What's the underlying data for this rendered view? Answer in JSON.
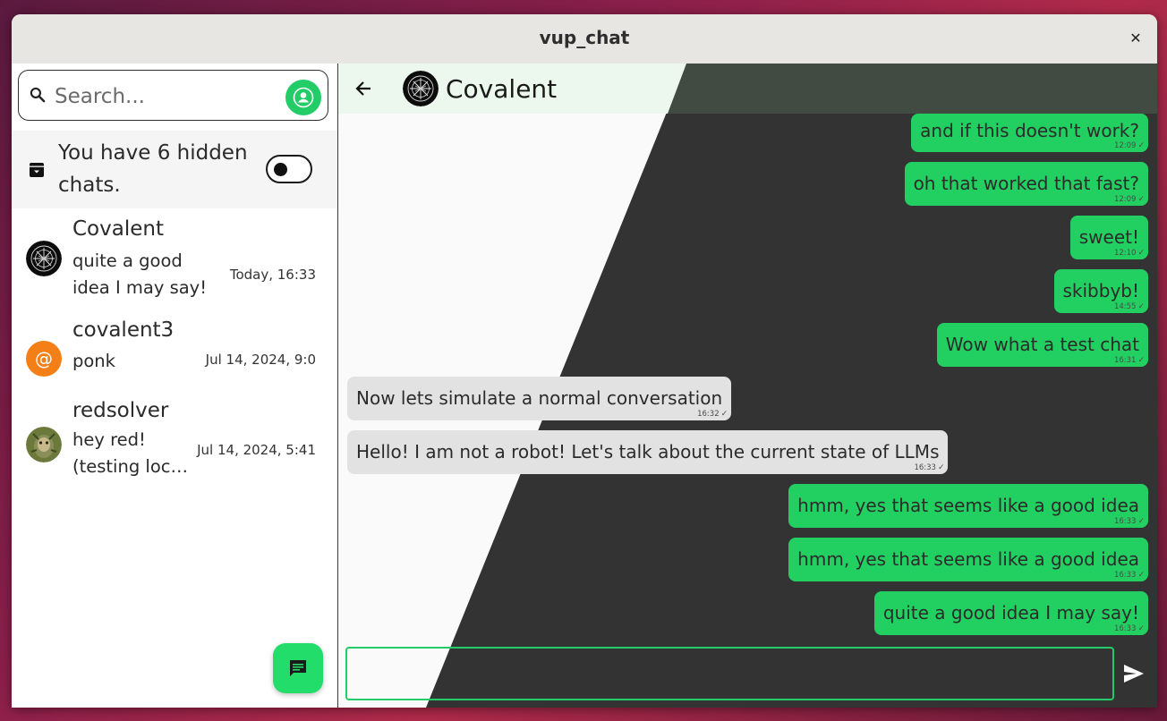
{
  "window": {
    "title": "vup_chat"
  },
  "sidebar": {
    "search_placeholder": "Search...",
    "hidden_chats_text": "You have 6 hidden chats.",
    "hidden_toggle_on": false,
    "chats": [
      {
        "name": "Covalent",
        "preview": "quite a good idea I may say!",
        "time": "Today, 16:33",
        "avatar": "covalent-logo"
      },
      {
        "name": "covalent3",
        "preview": "ponk",
        "time": "Jul 14, 2024, 9:0",
        "avatar": "at-sign",
        "avatar_color": "#f57f17"
      },
      {
        "name": "redsolver",
        "preview": "hey red! (testing loc…",
        "time": "Jul 14, 2024, 5:41",
        "avatar": "photo"
      }
    ]
  },
  "chat": {
    "name": "Covalent",
    "messages": [
      {
        "text": "and if this doesn't work?",
        "time": "12:09",
        "dir": "out"
      },
      {
        "text": "oh that worked that fast?",
        "time": "12:09",
        "dir": "out"
      },
      {
        "text": "sweet!",
        "time": "12:10",
        "dir": "out"
      },
      {
        "text": "skibbyb!",
        "time": "14:55",
        "dir": "out"
      },
      {
        "text": "Wow what a test chat",
        "time": "16:31",
        "dir": "out"
      },
      {
        "text": "Now lets simulate a normal conversation",
        "time": "16:32",
        "dir": "in"
      },
      {
        "text": "Hello! I am not a robot! Let's talk about the current state of LLMs",
        "time": "16:33",
        "dir": "in"
      },
      {
        "text": "hmm, yes that seems like a good idea",
        "time": "16:33",
        "dir": "out"
      },
      {
        "text": "hmm, yes that seems like a good idea",
        "time": "16:33",
        "dir": "out"
      },
      {
        "text": "quite a good idea I may say!",
        "time": "16:33",
        "dir": "out"
      }
    ],
    "input_value": ""
  },
  "colors": {
    "accent": "#22cc66",
    "outgoing_bubble": "#22d062",
    "incoming_bubble": "#e2e2e2",
    "dark_panel": "#333333"
  }
}
